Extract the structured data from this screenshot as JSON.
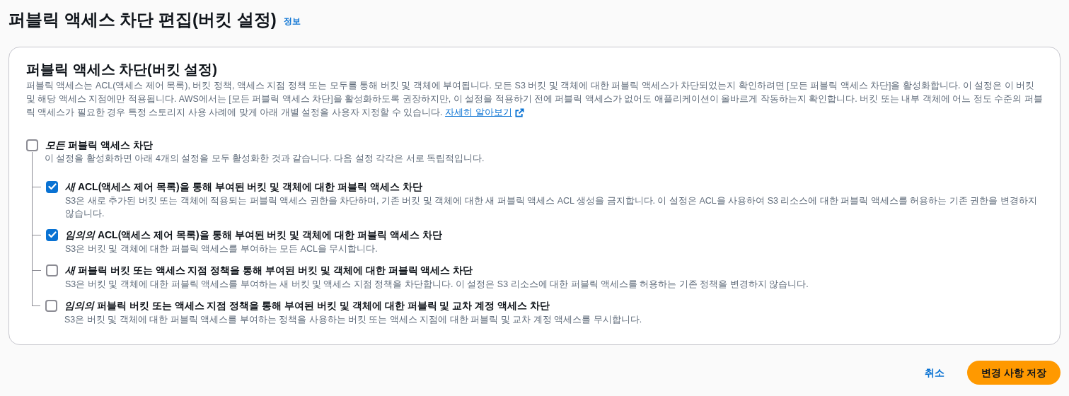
{
  "page": {
    "title": "퍼블릭 액세스 차단 편집(버킷 설정)",
    "info_link": "정보"
  },
  "panel": {
    "title": "퍼블릭 액세스 차단(버킷 설정)",
    "description": "퍼블릭 액세스는 ACL(액세스 제어 목록), 버킷 정책, 액세스 지점 정책 또는 모두를 통해 버킷 및 객체에 부여됩니다. 모든 S3 버킷 및 객체에 대한 퍼블릭 액세스가 차단되었는지 확인하려면 [모든 퍼블릭 액세스 차단]을 활성화합니다. 이 설정은 이 버킷 및 해당 액세스 지점에만 적용됩니다. AWS에서는 [모든 퍼블릭 액세스 차단]을 활성화하도록 권장하지만, 이 설정을 적용하기 전에 퍼블릭 액세스가 없어도 애플리케이션이 올바르게 작동하는지 확인합니다. 버킷 또는 내부 객체에 어느 정도 수준의 퍼블릭 액세스가 필요한 경우 특정 스토리지 사용 사례에 맞게 아래 개별 설정을 사용자 지정할 수 있습니다.",
    "learn_more_link": "자세히 알아보기",
    "block_all": {
      "label": "*모든* 퍼블릭 액세스 차단",
      "checked": false,
      "description": "이 설정을 활성화하면 아래 4개의 설정을 모두 활성화한 것과 같습니다. 다음 설정 각각은 서로 독립적입니다.",
      "children": [
        {
          "label": "*새* ACL(액세스 제어 목록)을 통해 부여된 버킷 및 객체에 대한 퍼블릭 액세스 차단",
          "checked": true,
          "description": "S3은 새로 추가된 버킷 또는 객체에 적용되는 퍼블릭 액세스 권한을 차단하며, 기존 버킷 및 객체에 대한 새 퍼블릭 액세스 ACL 생성을 금지합니다. 이 설정은 ACL을 사용하여 S3 리소스에 대한 퍼블릭 액세스를 허용하는 기존 권한을 변경하지 않습니다."
        },
        {
          "label": "*임의의* ACL(액세스 제어 목록)을 통해 부여된 버킷 및 객체에 대한 퍼블릭 액세스 차단",
          "checked": true,
          "description": "S3은 버킷 및 객체에 대한 퍼블릭 액세스를 부여하는 모든 ACL을 무시합니다."
        },
        {
          "label": "*새* 퍼블릭 버킷 또는 액세스 지점 정책을 통해 부여된 버킷 및 객체에 대한 퍼블릭 액세스 차단",
          "checked": false,
          "description": "S3은 버킷 및 객체에 대한 퍼블릭 액세스를 부여하는 새 버킷 및 액세스 지점 정책을 차단합니다. 이 설정은 S3 리소스에 대한 퍼블릭 액세스를 허용하는 기존 정책을 변경하지 않습니다."
        },
        {
          "label": "*임의의* 퍼블릭 버킷 또는 액세스 지점 정책을 통해 부여된 버킷 및 객체에 대한 퍼블릭 및 교차 계정 액세스 차단",
          "checked": false,
          "description": "S3은 버킷 및 객체에 대한 퍼블릭 액세스를 부여하는 정책을 사용하는 버킷 또는 액세스 지점에 대한 퍼블릭 및 교차 계정 액세스를 무시합니다."
        }
      ]
    }
  },
  "actions": {
    "cancel": "취소",
    "save": "변경 사항 저장"
  }
}
